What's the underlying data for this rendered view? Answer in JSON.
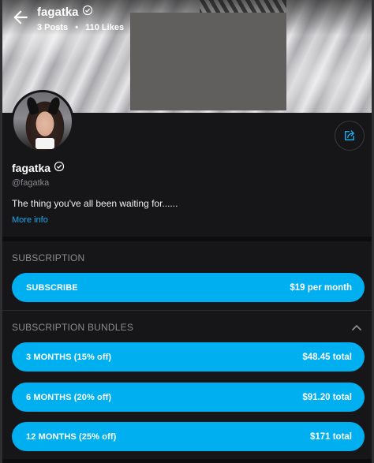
{
  "header": {
    "name": "fagatka",
    "posts": "3 Posts",
    "separator": "•",
    "likes": "110 Likes"
  },
  "profile": {
    "name": "fagatka",
    "handle": "@fagatka",
    "bio": "The thing you've all been waiting for......",
    "more_info": "More info"
  },
  "subscription": {
    "title": "SUBSCRIPTION",
    "button_label": "SUBSCRIBE",
    "button_price": "$19 per month"
  },
  "bundles": {
    "title": "SUBSCRIPTION BUNDLES",
    "items": [
      {
        "label": "3 MONTHS (15% off)",
        "price": "$48.45 total"
      },
      {
        "label": "6 MONTHS (20% off)",
        "price": "$91.20 total"
      },
      {
        "label": "12 MONTHS (25% off)",
        "price": "$171 total"
      }
    ]
  },
  "icons": {
    "back": "arrow-left-icon",
    "verified": "verified-badge-icon",
    "share": "share-icon",
    "collapse": "chevron-up-icon"
  },
  "colors": {
    "accent": "#00aff0",
    "link": "#1ba6ea",
    "background": "#161618"
  }
}
